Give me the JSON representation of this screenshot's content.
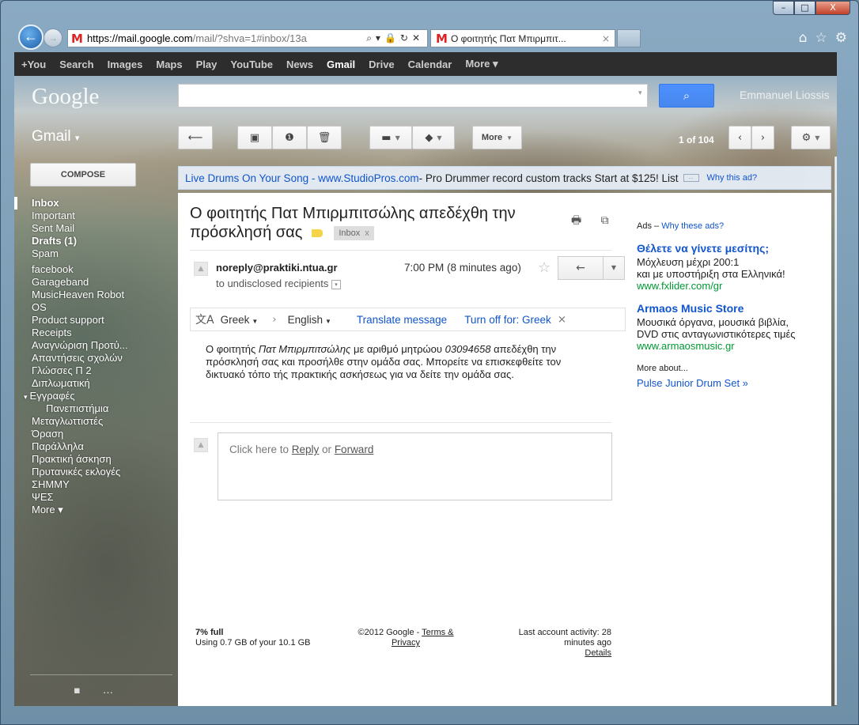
{
  "window": {
    "controls": [
      "–",
      "□",
      "X"
    ]
  },
  "browser": {
    "back_symbol": "←",
    "forward_symbol": "→",
    "url_host": "https://mail.google.com",
    "url_rest": "/mail/?shva=1#inbox/13a",
    "addr_controls": "⌕▾🔒↻✕",
    "tab_title": "Ο φοιτητής Πατ Μπιρμπιτ...",
    "tab_close": "×",
    "chrome_icons": [
      "⌂",
      "☆",
      "⚙"
    ]
  },
  "gbar": {
    "items": [
      "+You",
      "Search",
      "Images",
      "Maps",
      "Play",
      "YouTube",
      "News",
      "Gmail",
      "Drive",
      "Calendar",
      "More ▾"
    ],
    "active": "Gmail"
  },
  "header": {
    "logo": "Google",
    "search_value": "",
    "search_dropdown": "▾",
    "search_button_icon": "search-icon",
    "user_name": "Emmanuel Liossis"
  },
  "gmail_label": "Gmail",
  "gmail_label_caret": "▾",
  "toolbar": {
    "back": "⟵",
    "archive": "▣",
    "spam": "❶",
    "delete": "🗑",
    "move": "▬",
    "labels": "◆",
    "more_label": "More",
    "dropdown": "▼",
    "pager": "1 of 104",
    "newer": "‹",
    "older": "›",
    "settings": "⚙"
  },
  "compose_label": "COMPOSE",
  "nav": {
    "items": [
      {
        "label": "Inbox",
        "bold": true
      },
      {
        "label": "Important"
      },
      {
        "label": "Sent Mail"
      },
      {
        "label": "Drafts (1)",
        "bold": true
      },
      {
        "label": "Spam"
      },
      {
        "label": "facebook"
      },
      {
        "label": "Garageband"
      },
      {
        "label": "MusicHeaven Robot"
      },
      {
        "label": "OS"
      },
      {
        "label": "Product support"
      },
      {
        "label": "Receipts"
      },
      {
        "label": "Αναγνώριση Προτύ..."
      },
      {
        "label": "Απαντήσεις σχολών"
      },
      {
        "label": "Γλώσσες Π 2"
      },
      {
        "label": "Διπλωματική"
      },
      {
        "label": "Εγγραφές"
      },
      {
        "label": "Πανεπιστήμια"
      },
      {
        "label": "Μεταγλωττιστές"
      },
      {
        "label": "Όραση"
      },
      {
        "label": "Παράλληλα"
      },
      {
        "label": "Πρακτική άσκηση"
      },
      {
        "label": "Πρυτανικές εκλογές"
      },
      {
        "label": "ΣΗΜΜΥ"
      },
      {
        "label": "ΨΕΣ"
      },
      {
        "label": "More ▾"
      }
    ],
    "expand_arrow": "▾",
    "chat_icons": "▪ …"
  },
  "ad_bar": {
    "link_text": "Live Drums On Your Song - www.StudioPros.com",
    "text": " - Pro Drummer record custom tracks Start at $125! List",
    "ellipsis": "...",
    "why": "Why this ad?"
  },
  "message": {
    "subject": "Ο φοιτητής Πατ Μπιρμπιτσώλης απεδέχθη την πρόσκλησή σας",
    "inbox_chip": "Inbox",
    "chip_close": "x",
    "print_icons": "🖶 ⧉",
    "sender": "noreply@praktiki.ntua.gr",
    "to": "to undisclosed recipients",
    "to_dropdown": "▾",
    "time": "7:00 PM (8 minutes ago)",
    "star": "☆",
    "reply_icon": "←",
    "reply_dropdown": "▼",
    "body_1": "Ο φοιτητής ",
    "body_name": "Πατ Μπιρμπιτσώλης",
    "body_2": " με αριθμό μητρώου ",
    "body_id": "03094658",
    "body_3": " απεδέχθη την πρόσκλησή σας και προσήλθε στην ομάδα σας. Μπορείτε να επισκεφθείτε τον δικτυακό τόπο τής πρακτικής ασκήσεως για να δείτε την ομάδα σας."
  },
  "translate": {
    "icon": "文A",
    "from": "Greek",
    "arrow": "›",
    "to": "English",
    "action": "Translate message",
    "turn_off": "Turn off for: Greek",
    "close": "×"
  },
  "reply_box": {
    "prefix": "Click here to ",
    "reply": "Reply",
    "or": " or ",
    "forward": "Forward"
  },
  "footer": {
    "usage_pct": "7% full",
    "usage_text": "Using 0.7 GB of your 10.1 GB",
    "copyright": "©2012 Google - ",
    "terms": "Terms &",
    "privacy": "Privacy",
    "activity": "Last account activity: 28 minutes ago",
    "details": "Details"
  },
  "ads": {
    "header": "Ads – ",
    "why": "Why these ads?",
    "items": [
      {
        "title": "Θέλετε να γίνετε μεσίτης;",
        "line1": "Μόχλευση μέχρι 200:1",
        "line2": "και με υποστήριξη στα Ελληνικά!",
        "url": "www.fxlider.com/gr"
      },
      {
        "title": "Armaos Music Store",
        "line1": "Μουσικά όργανα, μουσικά βιβλία,",
        "line2": "DVD στις ανταγωνιστικότερες τιμές",
        "url": "www.armaosmusic.gr"
      }
    ],
    "more_about": "More about...",
    "more_link": "Pulse Junior Drum Set »"
  },
  "scrollbar": {
    "up": "▲",
    "down": "▼",
    "grip": "≡"
  },
  "colors": {
    "accent_blue": "#4d90fe",
    "link": "#1155cc",
    "ad_url": "#009933",
    "label_yellow": "#f5d44a"
  }
}
